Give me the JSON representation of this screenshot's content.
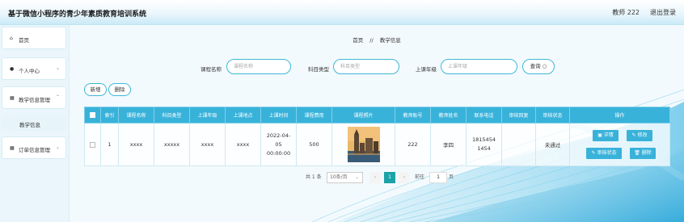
{
  "header": {
    "title": "基于微信小程序的青少年素质教育培训系统",
    "user": "教师 222",
    "logout": "退出登录"
  },
  "sidebar": {
    "items": [
      {
        "label": "首页",
        "icon": "home-icon"
      },
      {
        "label": "个人中心",
        "icon": "user-icon"
      },
      {
        "label": "教学信息管理",
        "icon": "grid-icon"
      },
      {
        "label": "教学信息",
        "icon": ""
      },
      {
        "label": "订单信息管理",
        "icon": "grid-icon"
      }
    ]
  },
  "breadcrumb": {
    "home": "首页",
    "sep": "//",
    "current": "教学信息"
  },
  "search": {
    "fields": [
      {
        "label": "课程名称",
        "placeholder": "课程名称"
      },
      {
        "label": "科目类型",
        "placeholder": "科目类型"
      },
      {
        "label": "上课年级",
        "placeholder": "上课年级"
      }
    ],
    "query_label": "查询"
  },
  "toolbar": {
    "add_label": "新增",
    "delete_label": "删除"
  },
  "table": {
    "columns": [
      "索引",
      "课程名称",
      "科目类型",
      "上课年级",
      "上课地点",
      "上课时间",
      "课程费用",
      "课程照片",
      "教师账号",
      "教师姓名",
      "联系电话",
      "审核回复",
      "审核状态",
      "操作"
    ],
    "rows": [
      {
        "index": "1",
        "course_name": "xxxx",
        "subject": "xxxxx",
        "grade": "xxxx",
        "location": "xxxx",
        "time": "2022-04-05 00:00:00",
        "fee": "500",
        "teacher_account": "222",
        "teacher_name": "李四",
        "phone": "18154541454",
        "review_reply": "",
        "review_status": "未通过",
        "actions": {
          "detail": "详情",
          "edit": "修改",
          "review": "审核状态",
          "delete": "删除"
        }
      }
    ]
  },
  "pagination": {
    "total": "共 1 条",
    "page_size": "10条/页",
    "current_page": "1",
    "jump_prefix": "前往",
    "jump_value": "1",
    "jump_suffix": "页"
  },
  "colors": {
    "accent": "#39b2da",
    "page_active": "#1ba3a8"
  }
}
